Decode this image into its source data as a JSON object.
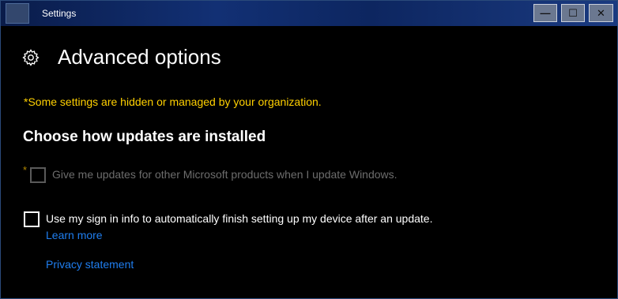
{
  "window": {
    "title": "Settings",
    "minimize_glyph": "—",
    "maximize_glyph": "☐",
    "close_glyph": "✕"
  },
  "page": {
    "title": "Advanced options",
    "icon": "gear-icon",
    "org_note": "*Some settings are hidden or managed by your organization.",
    "section_title": "Choose how updates are installed"
  },
  "options": [
    {
      "managed_marker": "*",
      "label": "Give me updates for other Microsoft products when I update Windows.",
      "checked": false,
      "disabled": true
    },
    {
      "label": "Use my sign in info to automatically finish setting up my device after an update.",
      "checked": false,
      "disabled": false
    }
  ],
  "links": {
    "learn_more": "Learn more",
    "privacy_statement": "Privacy statement"
  },
  "colors": {
    "accent_link": "#1f7ef0",
    "org_note": "#ffd000",
    "background": "#000000"
  }
}
